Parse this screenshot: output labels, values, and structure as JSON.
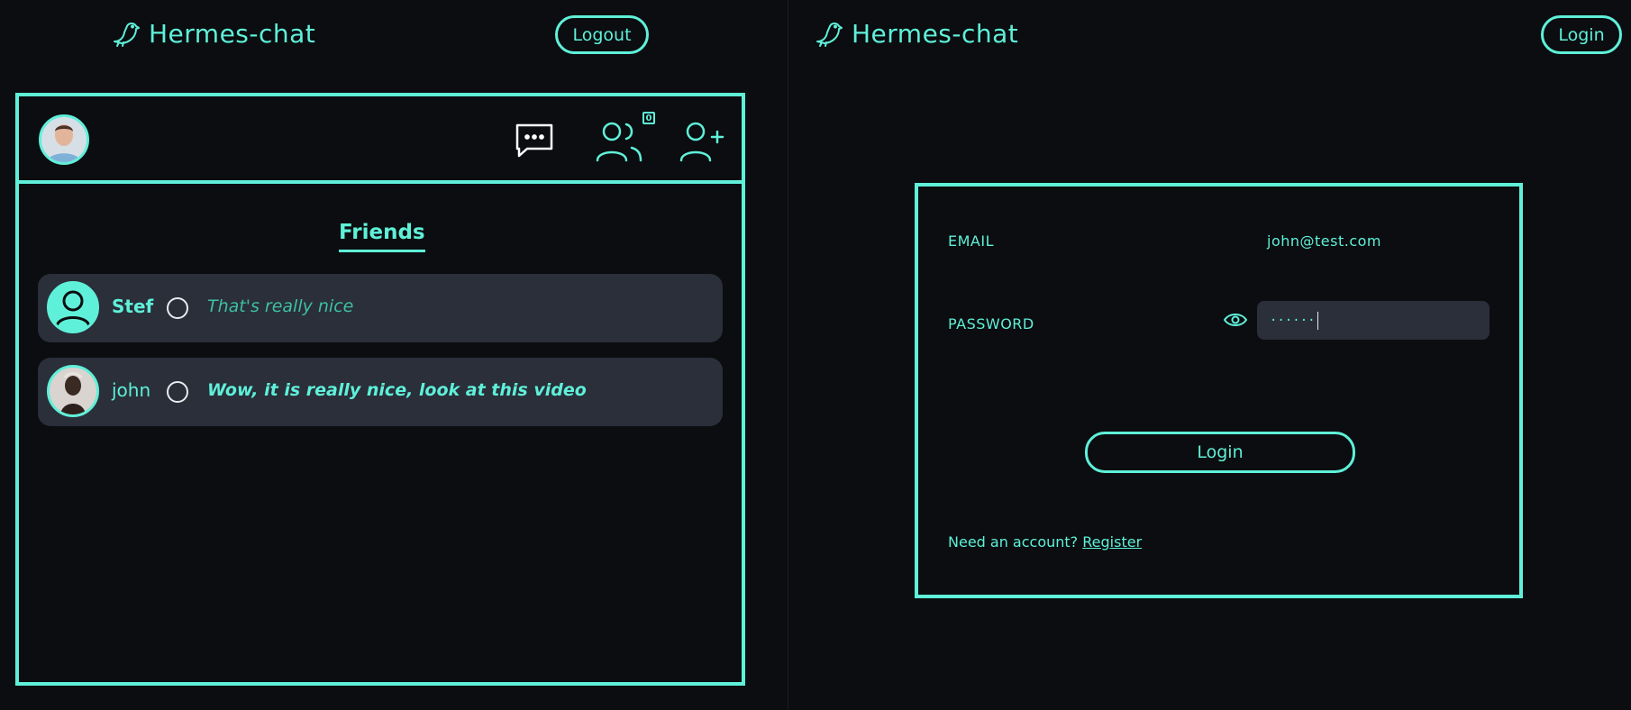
{
  "left_app": {
    "brand": "Hermes-chat",
    "logout_label": "Logout",
    "friend_requests_badge": "0",
    "friends_tab_label": "Friends",
    "friends": [
      {
        "name": "Stef",
        "last_message": "That's really nice",
        "message_color": "#3fbfa3",
        "avatar": "person-placeholder-icon"
      },
      {
        "name": "john",
        "last_message": "Wow, it is really nice, look at this video",
        "message_color": "#5ff0d9",
        "avatar": "photo"
      }
    ]
  },
  "right_app": {
    "brand": "Hermes-chat",
    "login_nav_label": "Login",
    "email_label": "EMAIL",
    "email_value": "john@test.com",
    "password_label": "PASSWORD",
    "password_value": "······",
    "login_button_label": "Login",
    "need_account_text": "Need an account?",
    "register_link": "Register"
  },
  "colors": {
    "accent": "#5ff0d9",
    "background": "#0b0d10",
    "card": "#2a2f3a"
  }
}
